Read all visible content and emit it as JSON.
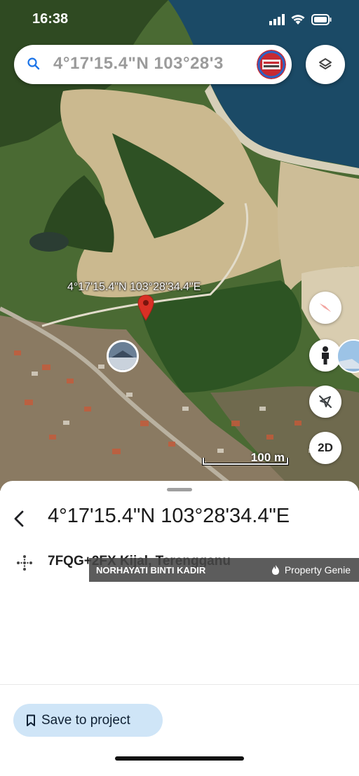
{
  "status_bar": {
    "time": "16:38"
  },
  "search": {
    "query": "4°17'15.4\"N 103°28'3"
  },
  "map": {
    "coordinate_label": "4°17'15.4\"N 103°28'34.4\"E",
    "scale_label": "100 m",
    "mode_button_label": "2D",
    "icons": [
      "compass-icon",
      "street-view-icon",
      "location-off-icon",
      "layers-icon"
    ]
  },
  "sheet": {
    "title": "4°17'15.4\"N 103°28'34.4\"E",
    "plus_code": "7FQG+2FX Kijal, Terengganu",
    "watermark_agent": "NORHAYATI BINTI KADIR",
    "watermark_brand": "Property Genie",
    "save_label": "Save to project"
  },
  "colors": {
    "accent": "#1a73e8",
    "pin": "#d93025",
    "save_bg": "#cfe5f7"
  }
}
